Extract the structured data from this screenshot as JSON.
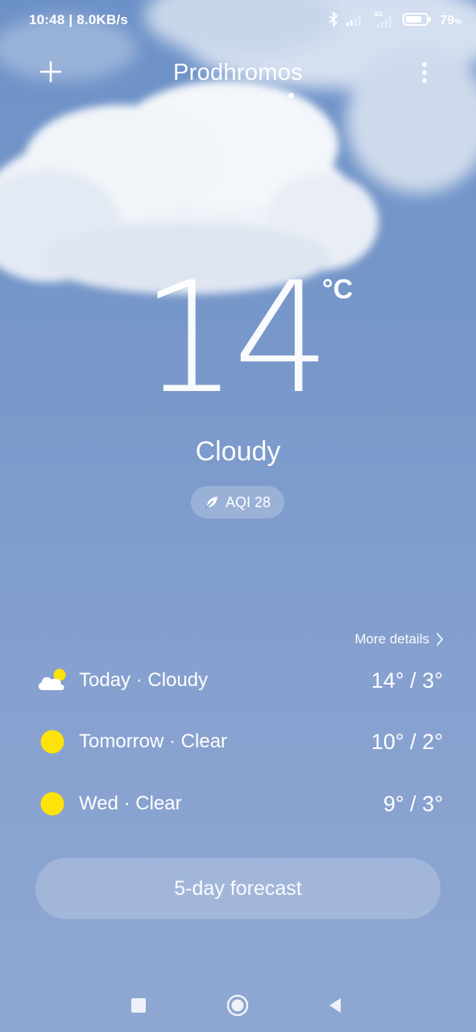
{
  "status_bar": {
    "time_speed": "10:48 | 8.0KB/s",
    "network_label": "4G",
    "battery_percent": "79",
    "battery_unit": "%",
    "battery_level": 0.79,
    "icons": [
      "bluetooth-icon",
      "signal-icon",
      "signal-4g-icon",
      "battery-icon"
    ]
  },
  "header": {
    "city": "Prodhromos",
    "page_count": 8,
    "active_page_index": 7
  },
  "current": {
    "temperature": "14",
    "unit": "°C",
    "condition": "Cloudy",
    "aqi_label": "AQI 28"
  },
  "forecast": {
    "more_details_label": "More details",
    "days": [
      {
        "label": "Today · Cloudy",
        "temps": "14° / 3°",
        "icon": "cloudy-sun-icon"
      },
      {
        "label": "Tomorrow · Clear",
        "temps": "10° / 2°",
        "icon": "sun-icon"
      },
      {
        "label": "Wed · Clear",
        "temps": "9° / 3°",
        "icon": "sun-icon"
      }
    ],
    "five_day_button": "5-day forecast"
  },
  "colors": {
    "sun": "#fde30a",
    "sky_top": "#6c91c8",
    "sky_bottom": "#8ea7d2"
  },
  "nav": {
    "icons": [
      "recents-square-icon",
      "home-circle-icon",
      "back-triangle-icon"
    ]
  }
}
